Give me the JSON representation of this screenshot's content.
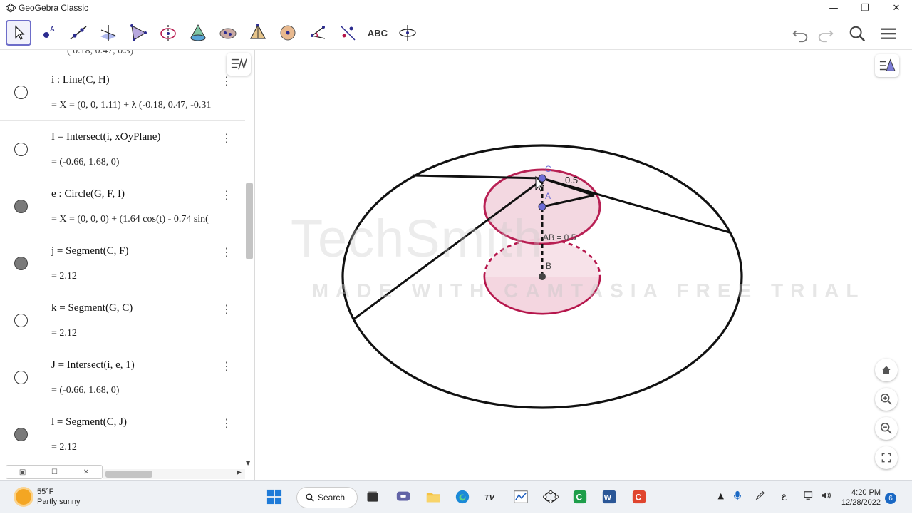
{
  "window": {
    "title": "GeoGebra Classic"
  },
  "toolbar": {
    "tools": [
      "move",
      "point",
      "line",
      "perpendicular",
      "polygon",
      "circle",
      "pyramid",
      "sphere",
      "angle",
      "reflect",
      "transform",
      "text",
      "rotate-view"
    ],
    "text_tool_label": "ABC",
    "selected_tool": "move"
  },
  "algebra": {
    "partial_top": "( 0.18, 0.47, 0.3)",
    "rows": [
      {
        "def": "i : Line(C, H)",
        "val": "= X = (0, 0, 1.11) + λ (-0.18, 0.47, -0.31",
        "filled": false
      },
      {
        "def": "I = Intersect(i, xOyPlane)",
        "val": "= (-0.66, 1.68, 0)",
        "filled": false
      },
      {
        "def": "e : Circle(G, F, I)",
        "val": "= X = (0, 0, 0) + (1.64 cos(t) - 0.74 sin(",
        "filled": true
      },
      {
        "def": "j = Segment(C, F)",
        "val": "= 2.12",
        "filled": true
      },
      {
        "def": "k = Segment(G, C)",
        "val": "= 2.12",
        "filled": false
      },
      {
        "def": "J = Intersect(i, e, 1)",
        "val": "= (-0.66, 1.68, 0)",
        "filled": false
      },
      {
        "def": "l = Segment(C, J)",
        "val": "= 2.12",
        "filled": true
      }
    ]
  },
  "graphics": {
    "labels": {
      "C": "C",
      "A": "A",
      "B": "B",
      "radius": "0.5",
      "ab": "AB = 0.5"
    },
    "watermark_logo": "TechSmith",
    "watermark_text": "MADE WITH CAMTASIA FREE TRIAL",
    "colors": {
      "cylinder_stroke": "#b5154b",
      "cylinder_fill": "#f3d6e0",
      "point": "#6b6bd6"
    }
  },
  "taskbar": {
    "weather_temp": "55°F",
    "weather_desc": "Partly sunny",
    "search_label": "Search",
    "time": "4:20 PM",
    "date": "12/28/2022",
    "notifications": "6",
    "lang": "ع"
  }
}
